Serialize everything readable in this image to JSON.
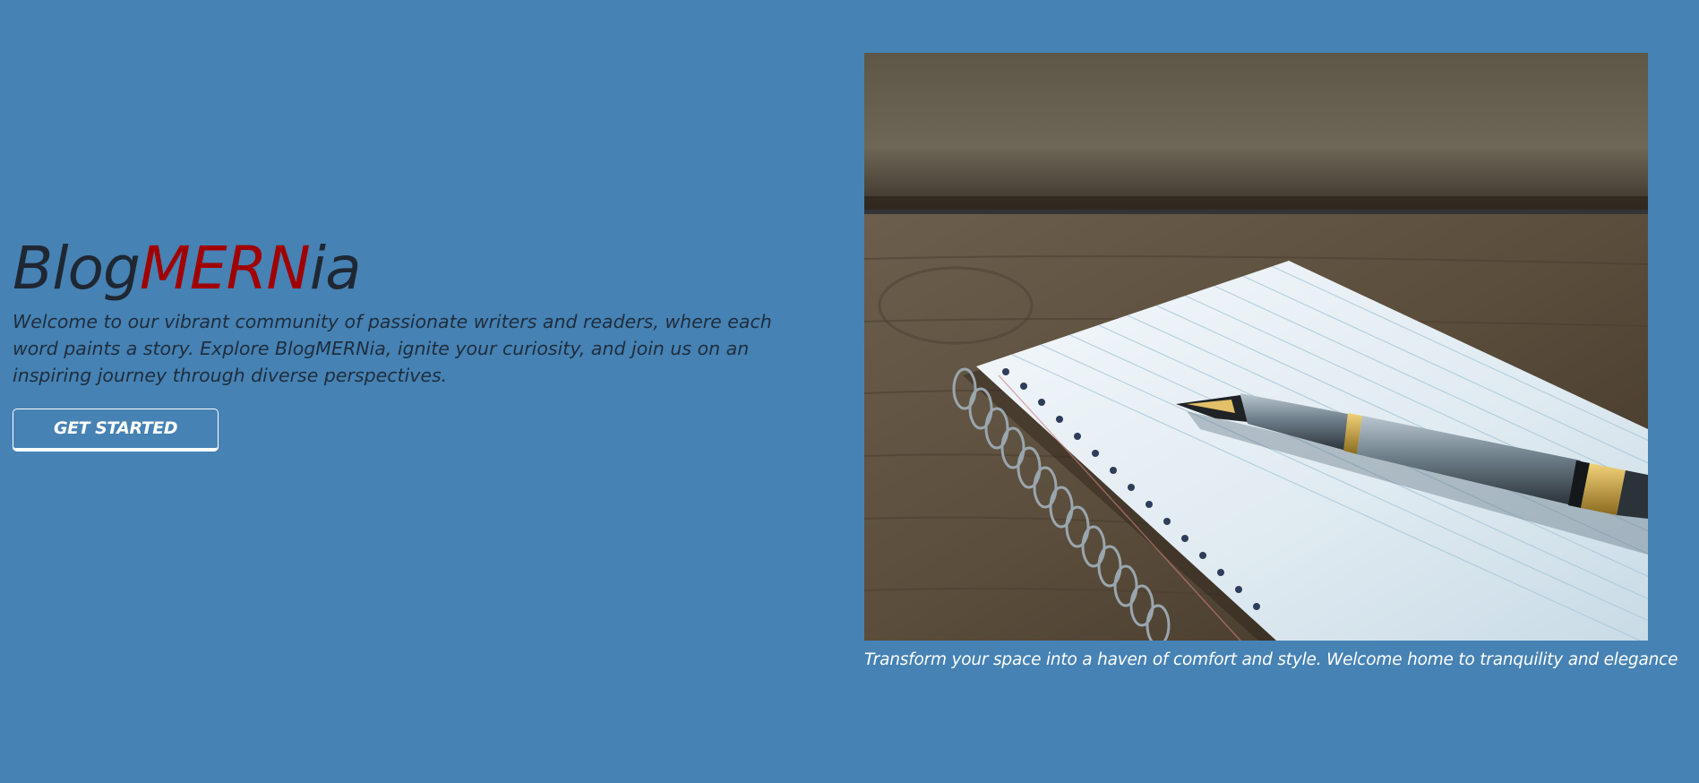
{
  "hero": {
    "brand": {
      "prefix": "Blog",
      "highlight": "MERN",
      "suffix": "ia"
    },
    "tagline": "Welcome to our vibrant community of passionate writers and readers, where each word paints a story. Explore BlogMERNia, ignite your curiosity, and join us on an inspiring journey through diverse perspectives.",
    "cta_label": "GET STARTED"
  },
  "figure": {
    "image_subject": "notebook-with-fountain-pen-on-wooden-table",
    "caption": "Transform your space into a haven of comfort and style. Welcome home to tranquility and elegance"
  },
  "colors": {
    "background": "#4682b4",
    "brand_text": "#1f2733",
    "brand_highlight": "#a10000",
    "button_border": "#ffffff"
  }
}
